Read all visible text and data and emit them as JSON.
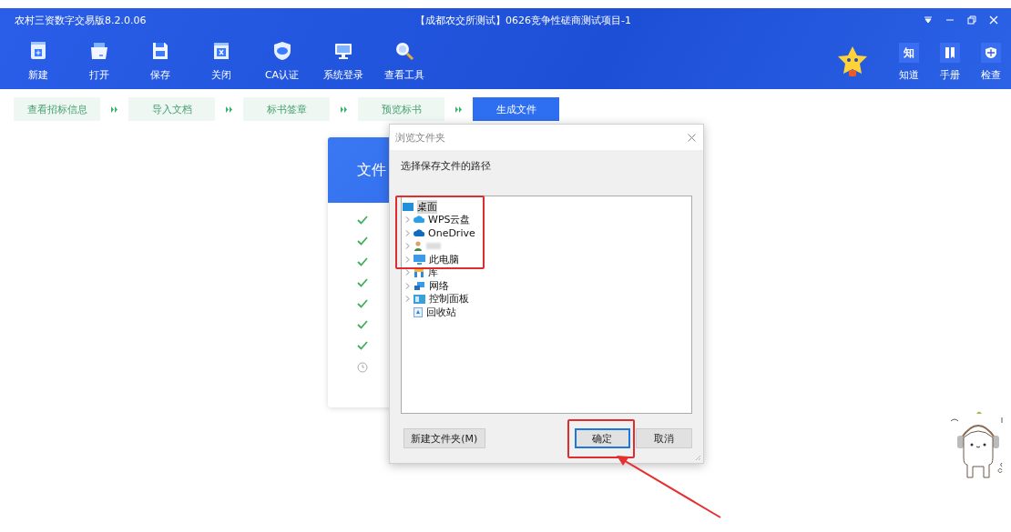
{
  "window": {
    "title": "农村三资数字交易版8.2.0.06",
    "project": "【成都农交所测试】0626竞争性磋商测试项目-1"
  },
  "toolbar": [
    {
      "label": "新建",
      "kind": "new"
    },
    {
      "label": "打开",
      "kind": "open"
    },
    {
      "label": "保存",
      "kind": "save"
    },
    {
      "label": "关闭",
      "kind": "close"
    },
    {
      "label": "CA认证",
      "kind": "ca"
    },
    {
      "label": "系统登录",
      "kind": "login"
    },
    {
      "label": "查看工具",
      "kind": "search"
    }
  ],
  "side_tools": [
    {
      "label": "知道",
      "kind": "know",
      "glyph": "知"
    },
    {
      "label": "手册",
      "kind": "manual"
    },
    {
      "label": "检查",
      "kind": "check"
    }
  ],
  "steps": [
    {
      "label": "查看招标信息",
      "selected": false
    },
    {
      "label": "导入文档",
      "selected": false
    },
    {
      "label": "标书签章",
      "selected": false
    },
    {
      "label": "预览标书",
      "selected": false
    },
    {
      "label": "生成文件",
      "selected": true
    }
  ],
  "progress_card": {
    "title": "文件",
    "items": [
      {
        "done": true
      },
      {
        "done": true
      },
      {
        "done": true
      },
      {
        "done": true
      },
      {
        "done": true
      },
      {
        "done": true
      },
      {
        "done": true
      },
      {
        "done": false
      }
    ]
  },
  "dialog": {
    "title": "浏览文件夹",
    "prompt": "选择保存文件的路径",
    "tree": [
      {
        "label": "桌面",
        "kind": "desktop",
        "selected": true,
        "expandable": false,
        "children": [
          {
            "label": "WPS云盘",
            "kind": "cloud-wps",
            "selected": false,
            "expandable": true
          },
          {
            "label": "OneDrive",
            "kind": "cloud",
            "selected": false,
            "expandable": true
          },
          {
            "kind": "user",
            "selected": false,
            "expandable": true,
            "redacted": true
          },
          {
            "label": "此电脑",
            "kind": "pc",
            "selected": false,
            "expandable": true
          },
          {
            "label": "库",
            "kind": "library",
            "selected": false,
            "expandable": true
          },
          {
            "label": "网络",
            "kind": "network",
            "selected": false,
            "expandable": true
          },
          {
            "label": "控制面板",
            "kind": "control",
            "selected": false,
            "expandable": true
          },
          {
            "label": "回收站",
            "kind": "recycle",
            "selected": false,
            "expandable": false
          }
        ]
      }
    ],
    "buttons": [
      {
        "label": "新建文件夹(M)",
        "kind": "new-folder",
        "focused": false
      },
      {
        "label": "确定",
        "kind": "ok",
        "focused": true
      },
      {
        "label": "取消",
        "kind": "cancel",
        "focused": false
      }
    ]
  }
}
